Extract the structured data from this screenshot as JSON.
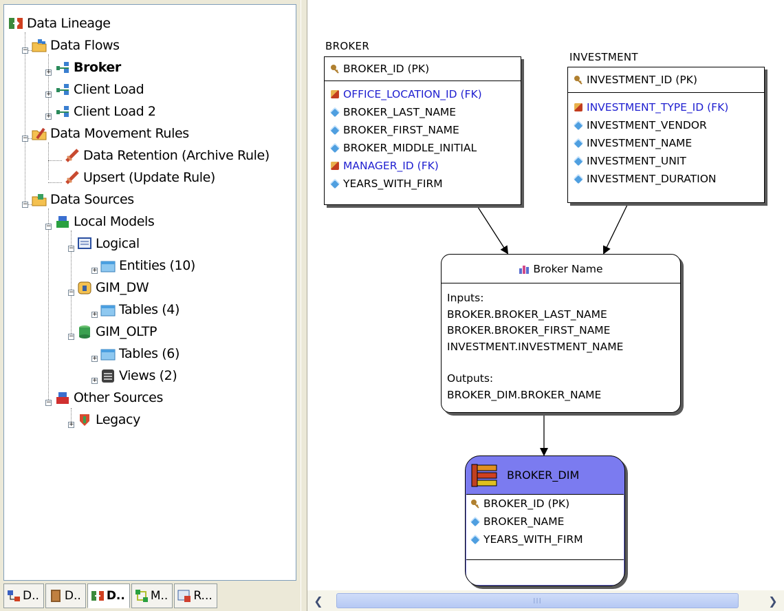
{
  "tree": {
    "root": "Data Lineage",
    "data_flows": "Data Flows",
    "broker": "Broker",
    "client_load": "Client Load",
    "client_load_2": "Client Load 2",
    "data_movement_rules": "Data Movement Rules",
    "data_retention": "Data Retention (Archive Rule)",
    "upsert": "Upsert (Update Rule)",
    "data_sources": "Data Sources",
    "local_models": "Local Models",
    "logical": "Logical",
    "entities": "Entities (10)",
    "gim_dw": "GIM_DW",
    "tables_4": "Tables (4)",
    "gim_oltp": "GIM_OLTP",
    "tables_6": "Tables (6)",
    "views_2": "Views (2)",
    "other_sources": "Other Sources",
    "legacy": "Legacy"
  },
  "tabs": [
    "D..",
    "D..",
    "D..",
    "M..",
    "R..."
  ],
  "diagram": {
    "broker": {
      "title": "BROKER",
      "pk": "BROKER_ID (PK)",
      "attrs": [
        {
          "name": "OFFICE_LOCATION_ID (FK)",
          "fk": true
        },
        {
          "name": "BROKER_LAST_NAME",
          "fk": false
        },
        {
          "name": "BROKER_FIRST_NAME",
          "fk": false
        },
        {
          "name": "BROKER_MIDDLE_INITIAL",
          "fk": false
        },
        {
          "name": "MANAGER_ID (FK)",
          "fk": true
        },
        {
          "name": "YEARS_WITH_FIRM",
          "fk": false
        }
      ]
    },
    "investment": {
      "title": "INVESTMENT",
      "pk": "INVESTMENT_ID (PK)",
      "attrs": [
        {
          "name": "INVESTMENT_TYPE_ID (FK)",
          "fk": true
        },
        {
          "name": "INVESTMENT_VENDOR",
          "fk": false
        },
        {
          "name": "INVESTMENT_NAME",
          "fk": false
        },
        {
          "name": "INVESTMENT_UNIT",
          "fk": false
        },
        {
          "name": "INVESTMENT_DURATION",
          "fk": false
        }
      ]
    },
    "transform": {
      "name": "Broker Name",
      "inputs_label": "Inputs:",
      "inputs": [
        "BROKER.BROKER_LAST_NAME",
        "BROKER.BROKER_FIRST_NAME",
        "INVESTMENT.INVESTMENT_NAME"
      ],
      "outputs_label": "Outputs:",
      "outputs": [
        "BROKER_DIM.BROKER_NAME"
      ]
    },
    "target": {
      "title": "BROKER_DIM",
      "pk": "BROKER_ID (PK)",
      "attrs": [
        "BROKER_NAME",
        "YEARS_WITH_FIRM"
      ]
    }
  },
  "scrollbar": {
    "thumb_grip": "III"
  },
  "colors": {
    "fk_text": "#1f1fd0",
    "target_fill": "#7b7bf0",
    "tree_border": "#7F9DB9"
  }
}
